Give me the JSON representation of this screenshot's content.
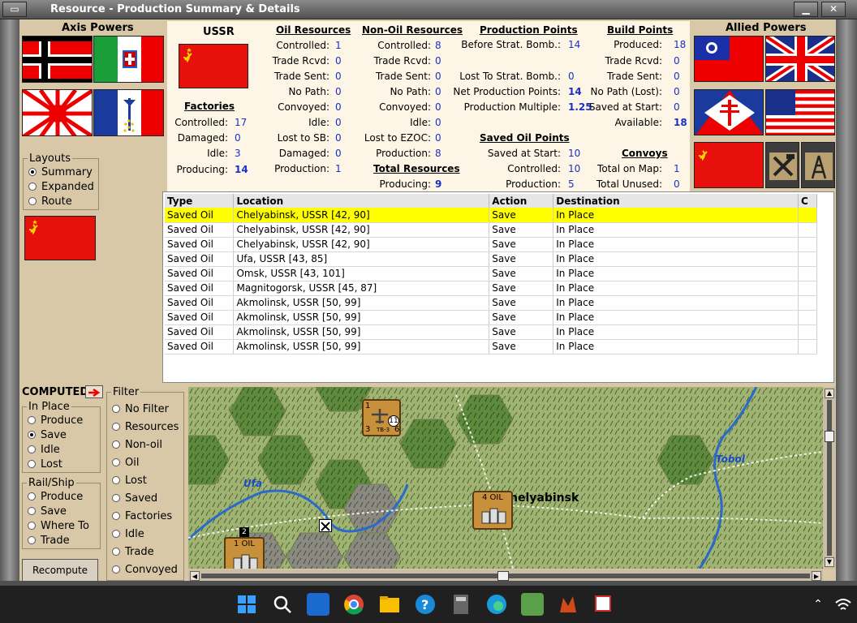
{
  "window": {
    "title": "Resource - Production Summary & Details"
  },
  "axis": {
    "title": "Axis Powers"
  },
  "allied": {
    "title": "Allied Powers"
  },
  "layouts": {
    "caption": "Layouts",
    "options": [
      "Summary",
      "Expanded",
      "Route"
    ],
    "selected": "Summary"
  },
  "summary": {
    "country": "USSR",
    "factories": {
      "title": "Factories",
      "controlled_l": "Controlled:",
      "controlled": "17",
      "damaged_l": "Damaged:",
      "damaged": "0",
      "idle_l": "Idle:",
      "idle": "3",
      "producing_l": "Producing:",
      "producing": "14"
    },
    "oil": {
      "title": "Oil Resources",
      "controlled_l": "Controlled:",
      "controlled": "1",
      "trade_rcvd_l": "Trade Rcvd:",
      "trade_rcvd": "0",
      "trade_sent_l": "Trade Sent:",
      "trade_sent": "0",
      "no_path_l": "No Path:",
      "no_path": "0",
      "convoyed_l": "Convoyed:",
      "convoyed": "0",
      "idle_l": "Idle:",
      "idle": "0",
      "lost_sb_l": "Lost to SB:",
      "lost_sb": "0",
      "damaged_l": "Damaged:",
      "damaged": "0",
      "production_l": "Production:",
      "production": "1"
    },
    "nonoil": {
      "title": "Non-Oil Resources",
      "controlled_l": "Controlled:",
      "controlled": "8",
      "trade_rcvd_l": "Trade Rcvd:",
      "trade_rcvd": "0",
      "trade_sent_l": "Trade Sent:",
      "trade_sent": "0",
      "no_path_l": "No Path:",
      "no_path": "0",
      "convoyed_l": "Convoyed:",
      "convoyed": "0",
      "idle_l": "Idle:",
      "idle": "0",
      "lost_ezoc_l": "Lost to EZOC:",
      "lost_ezoc": "0",
      "production_l": "Production:",
      "production": "8"
    },
    "total": {
      "title": "Total Resources",
      "producing_l": "Producing:",
      "producing": "9"
    },
    "pp": {
      "title": "Production Points",
      "before_l": "Before Strat. Bomb.:",
      "before": "14",
      "lost_l": "Lost To Strat. Bomb.:",
      "lost": "0",
      "net_l": "Net Production Points:",
      "net": "14",
      "mult_l": "Production Multiple:",
      "mult": "1.25"
    },
    "saved": {
      "title": "Saved Oil Points",
      "start_l": "Saved at Start:",
      "start": "10",
      "controlled_l": "Controlled:",
      "controlled": "10",
      "production_l": "Production:",
      "production": "5"
    },
    "bp": {
      "title": "Build Points",
      "produced_l": "Produced:",
      "produced": "18",
      "trade_rcvd_l": "Trade Rcvd:",
      "trade_rcvd": "0",
      "trade_sent_l": "Trade Sent:",
      "trade_sent": "0",
      "nopath_l": "No Path (Lost):",
      "nopath": "0",
      "saved_l": "Saved at Start:",
      "saved": "0",
      "available_l": "Available:",
      "available": "18"
    },
    "convoys": {
      "title": "Convoys",
      "total_map_l": "Total on Map:",
      "total_map": "1",
      "unused_l": "Total Unused:",
      "unused": "0"
    }
  },
  "table": {
    "headers": [
      "Type",
      "Location",
      "Action",
      "Destination",
      "C"
    ],
    "rows": [
      [
        "Saved Oil",
        "Chelyabinsk, USSR [42, 90]",
        "Save",
        "In Place"
      ],
      [
        "Saved Oil",
        "Chelyabinsk, USSR [42, 90]",
        "Save",
        "In Place"
      ],
      [
        "Saved Oil",
        "Chelyabinsk, USSR [42, 90]",
        "Save",
        "In Place"
      ],
      [
        "Saved Oil",
        "Ufa, USSR [43, 85]",
        "Save",
        "In Place"
      ],
      [
        "Saved Oil",
        "Omsk, USSR [43, 101]",
        "Save",
        "In Place"
      ],
      [
        "Saved Oil",
        "Magnitogorsk, USSR [45, 87]",
        "Save",
        "In Place"
      ],
      [
        "Saved Oil",
        "Akmolinsk, USSR [50, 99]",
        "Save",
        "In Place"
      ],
      [
        "Saved Oil",
        "Akmolinsk, USSR [50, 99]",
        "Save",
        "In Place"
      ],
      [
        "Saved Oil",
        "Akmolinsk, USSR [50, 99]",
        "Save",
        "In Place"
      ],
      [
        "Saved Oil",
        "Akmolinsk, USSR [50, 99]",
        "Save",
        "In Place"
      ]
    ]
  },
  "computed": {
    "label": "COMPUTED"
  },
  "inplace": {
    "caption": "In Place",
    "options": [
      "Produce",
      "Save",
      "Idle",
      "Lost"
    ],
    "selected": "Save"
  },
  "railship": {
    "caption": "Rail/Ship",
    "options": [
      "Produce",
      "Save",
      "Where To",
      "Trade"
    ]
  },
  "filter": {
    "caption": "Filter",
    "options": [
      "No Filter",
      "Resources",
      "Non-oil",
      "Oil",
      "Lost",
      "Saved",
      "Factories",
      "Idle",
      "Trade",
      "Convoyed"
    ]
  },
  "recompute": {
    "label": "Recompute"
  },
  "map": {
    "ufa": "Ufa",
    "tobol": "Tobol",
    "chelyabinsk": "helyabinsk",
    "oil4": "4 OIL",
    "oil1": "1 OIL",
    "unit_type": "TB-3",
    "unit_top": "1",
    "unit_left": "3",
    "unit_right": "6",
    "unit_badge": "11",
    "stack": "2"
  },
  "colors": {
    "selected_row": "#ffff00",
    "value_blue": "#1a2fc8",
    "ussr_red": "#e8100a"
  }
}
